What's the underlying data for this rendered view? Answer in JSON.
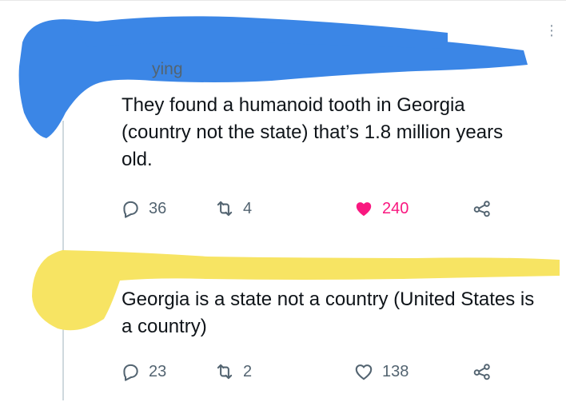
{
  "tweet1": {
    "replying_fragment": "ying",
    "text": "They found a humanoid tooth in Georgia (country not the state) that’s 1.8 million years old.",
    "replies": "36",
    "retweets": "4",
    "likes": "240",
    "liked": true,
    "redaction_color": "#3b86e6"
  },
  "tweet2": {
    "text": "Georgia is a state not a country (United States is a country)",
    "replies": "23",
    "retweets": "2",
    "likes": "138",
    "liked": false,
    "redaction_color": "#f7e463"
  },
  "icons": {
    "reply": "reply-icon",
    "retweet": "retweet-icon",
    "like": "heart-icon",
    "share": "share-icon",
    "more": "more-icon"
  },
  "colors": {
    "text": "#0f1419",
    "muted": "#536471",
    "like_active": "#f91880",
    "thread_line": "#cfd9de"
  }
}
